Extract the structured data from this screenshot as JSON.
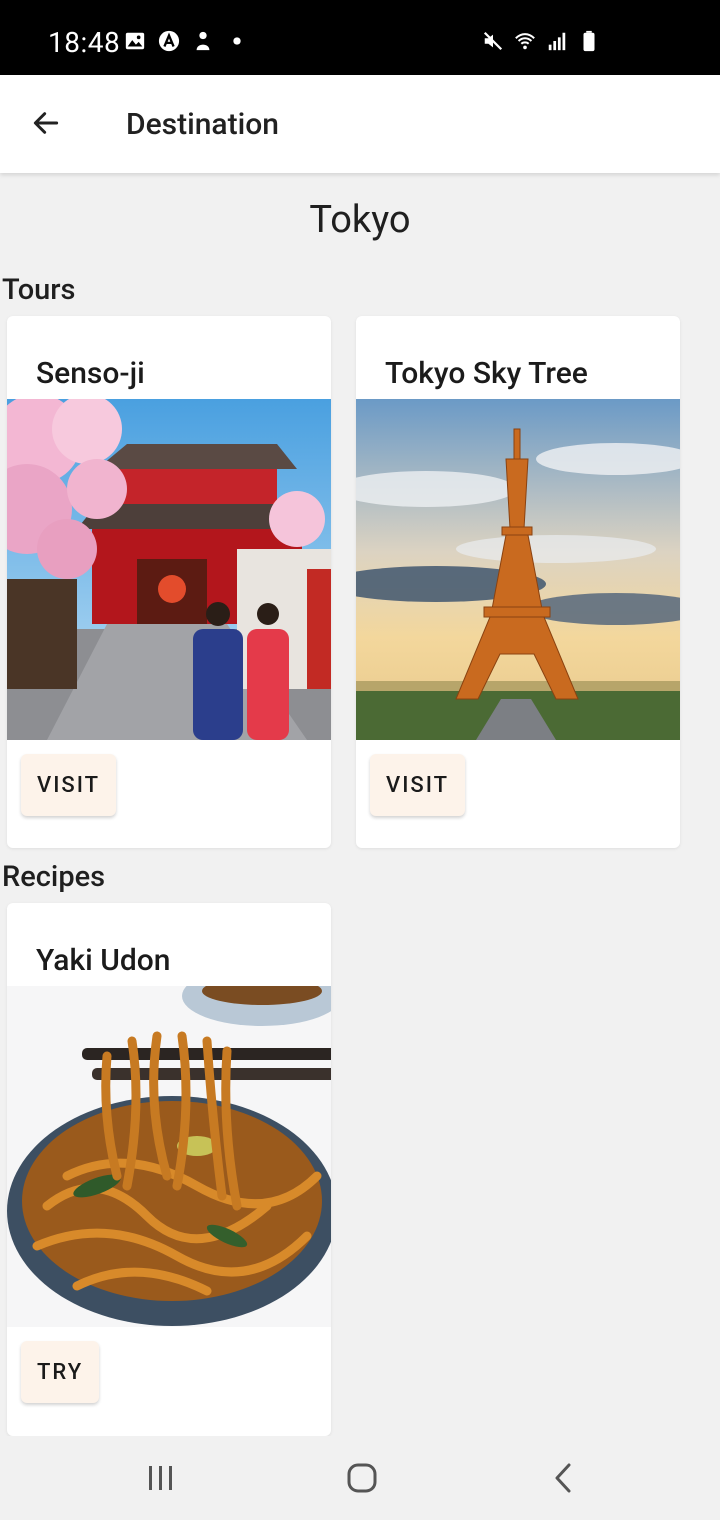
{
  "status_bar": {
    "time": "18:48",
    "left_icons": [
      "image-icon",
      "app-a-icon",
      "notification-person-icon",
      "dot-icon"
    ],
    "right_icons": [
      "mute-icon",
      "wifi-icon",
      "signal-icon",
      "battery-icon"
    ]
  },
  "app_bar": {
    "back_icon": "arrow-left-icon",
    "title": "Destination"
  },
  "page": {
    "city": "Tokyo"
  },
  "sections": {
    "tours": {
      "heading": "Tours",
      "cards": [
        {
          "title": "Senso-ji",
          "button": "VISIT",
          "image": "temple-photo"
        },
        {
          "title": "Tokyo Sky Tree",
          "button": "VISIT",
          "image": "tower-photo"
        }
      ]
    },
    "recipes": {
      "heading": "Recipes",
      "cards": [
        {
          "title": "Yaki Udon",
          "button": "TRY",
          "image": "noodles-photo"
        }
      ]
    }
  },
  "nav_bar": {
    "buttons": [
      "recents-icon",
      "home-icon",
      "back-icon"
    ]
  },
  "colors": {
    "background": "#f1f1f1",
    "card": "#ffffff",
    "button_bg": "#fdf3ea",
    "status_bar": "#000000"
  }
}
